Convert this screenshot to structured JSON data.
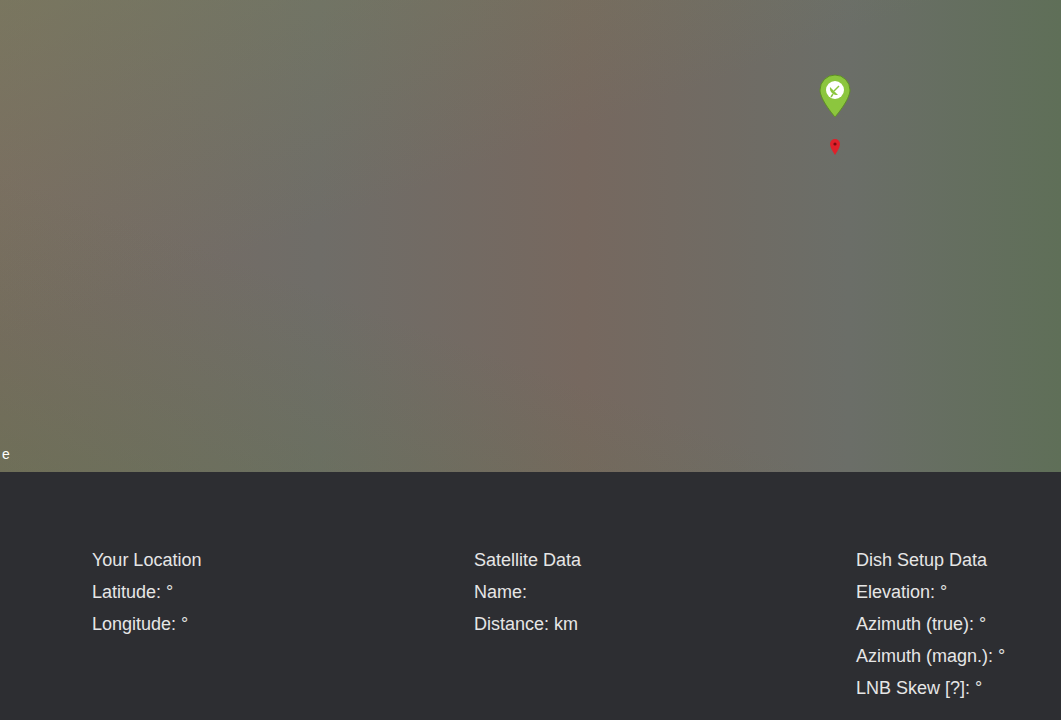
{
  "map": {
    "attribution": "e",
    "pins": [
      {
        "name": "satellite-pin",
        "color": "#8cc63e"
      },
      {
        "name": "location-pin",
        "color": "#e0202a"
      }
    ]
  },
  "panel": {
    "columns": [
      {
        "title": "Your Location",
        "lines": [
          "Latitude: °",
          "Longitude: °"
        ]
      },
      {
        "title": "Satellite Data",
        "lines": [
          "Name:",
          "Distance: km"
        ]
      },
      {
        "title": "Dish Setup Data",
        "lines": [
          "Elevation: °",
          "Azimuth (true): °",
          "Azimuth (magn.): °",
          "LNB Skew [?]: °"
        ]
      }
    ]
  }
}
